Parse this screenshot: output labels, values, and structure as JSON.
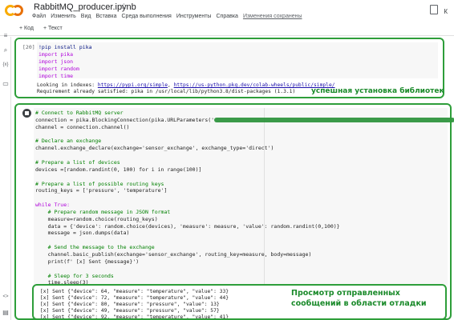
{
  "header": {
    "title": "RabbitMQ_producer.ipynb",
    "menu": [
      "Файл",
      "Изменить",
      "Вид",
      "Вставка",
      "Среда выполнения",
      "Инструменты",
      "Справка"
    ],
    "saved_status": "Изменения сохранены",
    "account_letter": "К"
  },
  "toolbar": {
    "add_code": "+ Код",
    "add_text": "+ Текст"
  },
  "rail_icons": [
    "menu-icon",
    "search-icon",
    "variables-icon",
    "files-icon",
    "code-icon",
    "terminal-icon"
  ],
  "cell1": {
    "exec_count": "[20]",
    "code": [
      "!pip install pika",
      "import pika",
      "import json",
      "import random",
      "import time"
    ],
    "output_prefix": "Looking in indexes: ",
    "output_link1": "https://pypi.org/simple",
    "output_sep": ", ",
    "output_link2": "https://us-python.pkg.dev/colab-wheels/public/simple/",
    "output_line2": "Requirement already satisfied: pika in /usr/local/lib/python3.8/dist-packages (1.3.1)"
  },
  "cell2": {
    "code": [
      "# Connect to RabbitMQ server",
      "connection = pika.BlockingConnection(pika.URLParameters('",
      "channel = connection.channel()",
      "",
      "# Declare an exchange",
      "channel.exchange_declare(exchange='sensor_exchange', exchange_type='direct')",
      "",
      "# Prepare a list of devices",
      "devices =[random.randint(0, 100) for i in range(100)]",
      "",
      "# Prepare a list of possible routing keys",
      "routing_keys = ['pressure', 'temperature']",
      "",
      "while True:",
      "    # Prepare random message in JSON format",
      "    measure=random.choice(routing_keys)",
      "    data = {'device': random.choice(devices), 'measure': measure, 'value': random.randint(0,100)}",
      "    message = json.dumps(data)",
      "",
      "    # Send the message to the exchange",
      "    channel.basic_publish(exchange='sensor_exchange', routing_key=measure, body=message)",
      "    print(f' [x] Sent {message}')",
      "",
      "    # Sleep for 3 seconds",
      "    time.sleep(3)"
    ],
    "line2_tail": "y'))",
    "output": [
      "[x] Sent {\"device\": 64, \"measure\": \"temperature\", \"value\": 33}",
      "[x] Sent {\"device\": 72, \"measure\": \"temperature\", \"value\": 44}",
      "[x] Sent {\"device\": 80, \"measure\": \"pressure\", \"value\": 13}",
      "[x] Sent {\"device\": 49, \"measure\": \"pressure\", \"value\": 57}",
      "[x] Sent {\"device\": 92, \"measure\": \"temperature\", \"value\": 41}"
    ]
  },
  "annotations": {
    "install": "успешная установка библиотек",
    "debug_line1": "Просмотр отправленных",
    "debug_line2": "сообщений в области отладки"
  },
  "colors": {
    "annotation": "#2e9e3a",
    "logo_yellow": "#f9ab00",
    "logo_orange": "#e8710a"
  }
}
